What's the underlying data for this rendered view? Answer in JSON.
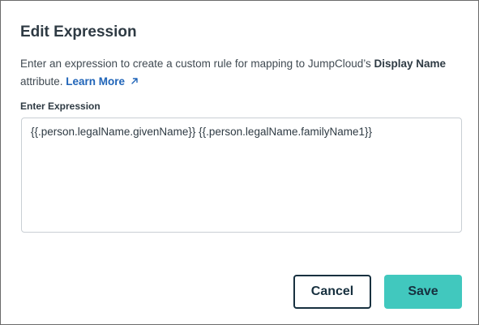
{
  "dialog": {
    "title": "Edit Expression",
    "description_prefix": "Enter an expression to create a custom rule for mapping to JumpCloud’s ",
    "description_bold": "Display Name",
    "description_suffix": " attribute. ",
    "learn_more_label": "Learn More",
    "learn_more_icon": "external-arrow-icon",
    "field_label": "Enter Expression",
    "expression_value": "{{.person.legalName.givenName}} {{.person.legalName.familyName1}}",
    "cancel_label": "Cancel",
    "save_label": "Save"
  },
  "colors": {
    "accent": "#41c8be",
    "link": "#1f64b8",
    "text_dark": "#17303f"
  }
}
